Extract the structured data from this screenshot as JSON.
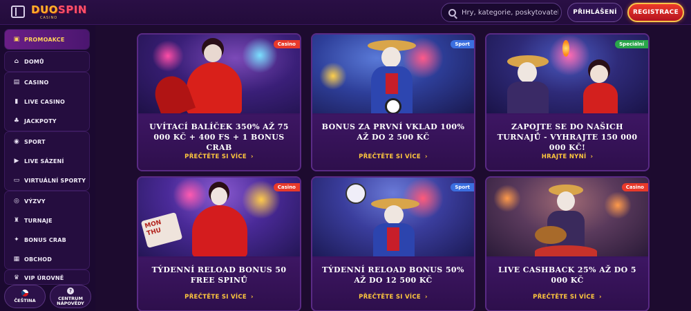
{
  "header": {
    "logo_part1": "DUO",
    "logo_part2": "SPIN",
    "logo_tagline": "CASINO",
    "search_placeholder": "Hry, kategorie, poskytovatelé",
    "login_label": "PŘIHLÁŠENÍ",
    "register_label": "REGISTRACE"
  },
  "sidebar": {
    "groups": [
      [
        {
          "label": "PROMOAKCE",
          "icon": "gift-icon",
          "active": true
        }
      ],
      [
        {
          "label": "DOMŮ",
          "icon": "home-icon"
        }
      ],
      [
        {
          "label": "CASINO",
          "icon": "slot-machine-icon"
        },
        {
          "label": "LIVE CASINO",
          "icon": "cards-icon"
        },
        {
          "label": "JACKPOTY",
          "icon": "clover-icon"
        }
      ],
      [
        {
          "label": "SPORT",
          "icon": "ball-icon"
        },
        {
          "label": "LIVE SÁZENÍ",
          "icon": "play-icon"
        },
        {
          "label": "VIRTUÁLNÍ SPORTY",
          "icon": "monitor-icon"
        }
      ],
      [
        {
          "label": "VÝZVY",
          "icon": "target-icon"
        },
        {
          "label": "TURNAJE",
          "icon": "trophy-icon"
        },
        {
          "label": "BONUS CRAB",
          "icon": "claw-icon"
        },
        {
          "label": "OBCHOD",
          "icon": "shop-icon"
        }
      ],
      [
        {
          "label": "VIP ÚROVNĚ",
          "icon": "crown-icon"
        }
      ]
    ],
    "language_label": "ČEŠTINA",
    "help_label_1": "CENTRUM",
    "help_label_2": "NÁPOVĚDY"
  },
  "cards": [
    {
      "badge": "Casino",
      "badge_type": "casino",
      "title": "UVÍTACÍ BALÍČEK 350% AŽ 75 000 KČ + 400 FS + 1 BONUS CRAB",
      "cta": "PŘEČTĚTE SI VÍCE"
    },
    {
      "badge": "Sport",
      "badge_type": "sport",
      "title": "BONUS ZA PRVNÍ VKLAD 100% AŽ DO 2 500 KČ",
      "cta": "PŘEČTĚTE SI VÍCE"
    },
    {
      "badge": "Speciální",
      "badge_type": "special",
      "title": "ZAPOJTE SE DO NAŠICH TURNAJŮ - VYHRAJTE 150 000 000 KČ!",
      "cta": "HRAJTE NYNÍ"
    },
    {
      "badge": "Casino",
      "badge_type": "casino",
      "title": "TÝDENNÍ RELOAD BONUS 50 FREE SPINŮ",
      "cta": "PŘEČTĚTE SI VÍCE"
    },
    {
      "badge": "Sport",
      "badge_type": "sport",
      "title": "TÝDENNÍ RELOAD BONUS 50% AŽ DO 12 500 KČ",
      "cta": "PŘEČTĚTE SI VÍCE"
    },
    {
      "badge": "Casino",
      "badge_type": "casino",
      "title": "LIVE CASHBACK 25% AŽ DO 5 000 KČ",
      "cta": "PŘEČTĚTE SI VÍCE"
    }
  ],
  "card4_sign_text": "MON THU",
  "colors": {
    "accent_gold": "#ffc83d",
    "register_red": "#d8242a",
    "panel_purple": "#3a1460"
  }
}
